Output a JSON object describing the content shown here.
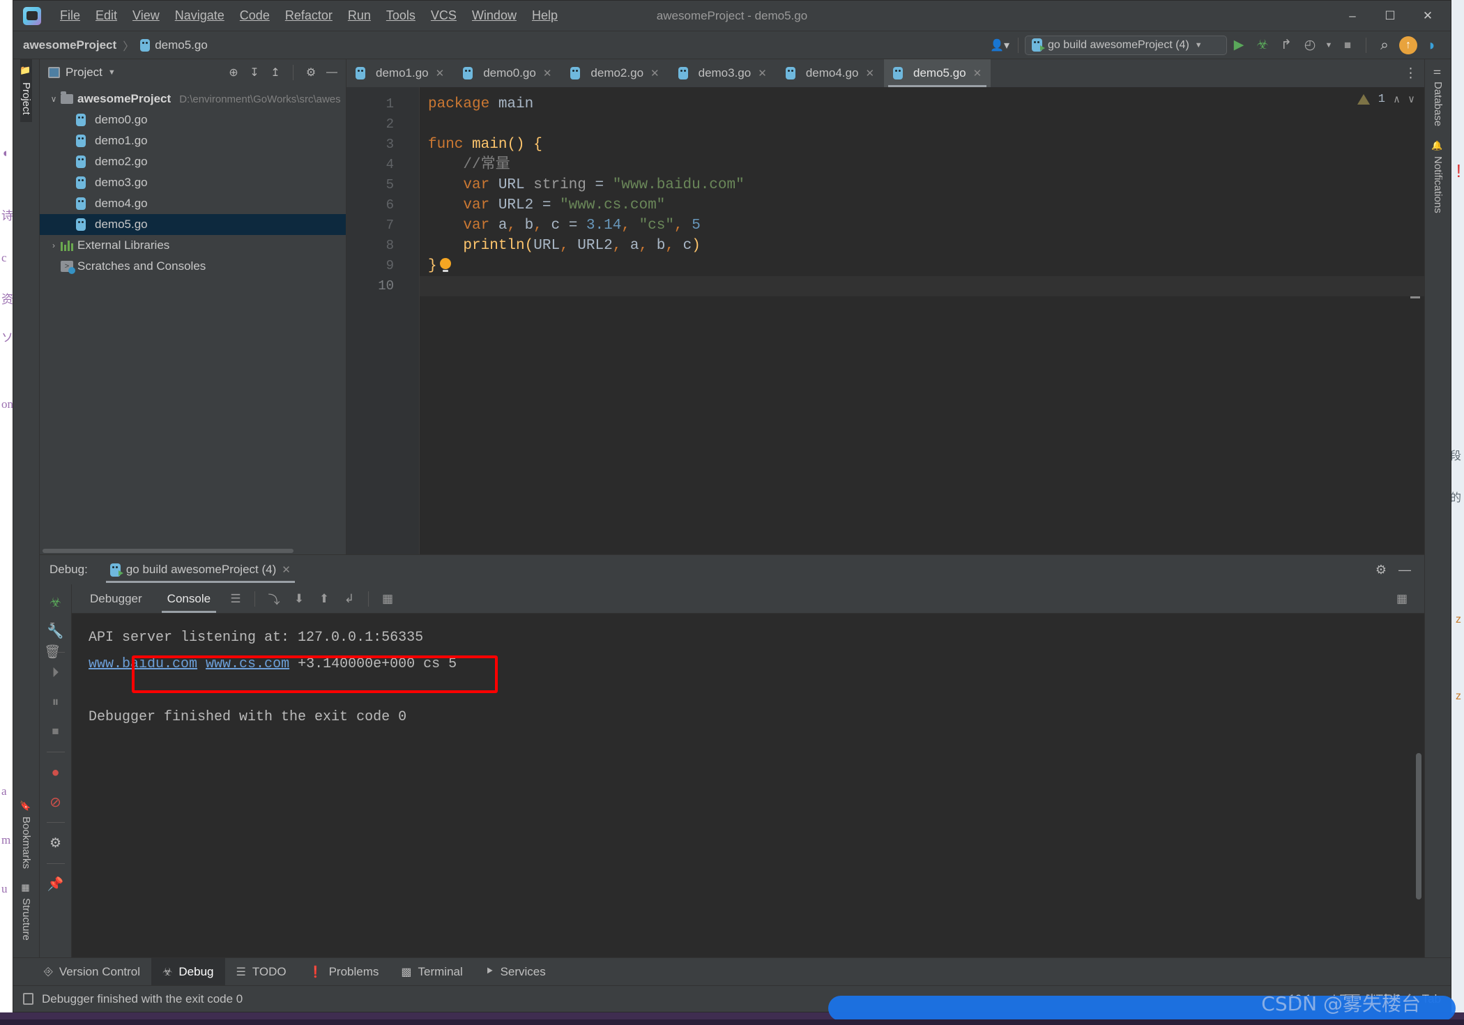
{
  "window": {
    "title": "awesomeProject - demo5.go",
    "app_icon": "go-logo-icon",
    "minimize": "–",
    "maximize": "☐",
    "close": "✕"
  },
  "menubar": {
    "items": [
      {
        "label": "File"
      },
      {
        "label": "Edit"
      },
      {
        "label": "View"
      },
      {
        "label": "Navigate"
      },
      {
        "label": "Code"
      },
      {
        "label": "Refactor"
      },
      {
        "label": "Run"
      },
      {
        "label": "Tools"
      },
      {
        "label": "VCS"
      },
      {
        "label": "Window"
      },
      {
        "label": "Help"
      }
    ]
  },
  "navbar": {
    "breadcrumb": [
      {
        "label": "awesomeProject",
        "bold": true
      },
      {
        "label": "demo5.go",
        "bold": false,
        "icon": "go-file-icon"
      }
    ],
    "separator": "〉",
    "user_icon": "user-avatar-icon",
    "run_config": {
      "icon": "go-run-config-icon",
      "label": "go build awesomeProject (4)",
      "caret": "▼"
    },
    "buttons": [
      {
        "name": "run-button",
        "glyph": "▶",
        "color": "#5aa85a"
      },
      {
        "name": "debug-button",
        "glyph": "☣",
        "color": "#5aa85a"
      },
      {
        "name": "run-with-coverage-button",
        "glyph": "↱",
        "color": "#b0b0b0"
      },
      {
        "name": "profiler-button",
        "glyph": "◴",
        "color": "#b0b0b0"
      },
      {
        "name": "profiler-dropdown",
        "glyph": "▼",
        "color": "#b0b0b0"
      },
      {
        "name": "stop-button",
        "glyph": "■",
        "color": "#9a9a9a"
      },
      {
        "name": "search-everywhere-button",
        "glyph": "⌕",
        "color": "#c8c8c8"
      },
      {
        "name": "update-button",
        "glyph": "↑",
        "color": "#e8a33d"
      },
      {
        "name": "ide-feature-button",
        "glyph": "◗",
        "color": "#3aa0d8"
      }
    ]
  },
  "left_strip": {
    "top_tabs": [
      {
        "label": "Project",
        "icon": "folder-icon",
        "active": true
      }
    ],
    "bottom_tabs": [
      {
        "label": "Bookmarks",
        "icon": "bookmark-icon",
        "active": false
      },
      {
        "label": "Structure",
        "icon": "structure-icon",
        "active": false
      }
    ]
  },
  "right_strip": {
    "tabs": [
      {
        "label": "Database",
        "icon": "database-icon"
      },
      {
        "label": "Notifications",
        "icon": "bell-icon"
      }
    ]
  },
  "project_panel": {
    "title": "Project",
    "title_caret": "▼",
    "tools": [
      {
        "name": "select-opened-file-button",
        "glyph": "⊕"
      },
      {
        "name": "expand-all-button",
        "glyph": "↧"
      },
      {
        "name": "collapse-all-button",
        "glyph": "↥"
      },
      {
        "name": "settings-button",
        "glyph": "⚙"
      },
      {
        "name": "hide-button",
        "glyph": "—"
      }
    ],
    "tree": [
      {
        "name": "awesomeProject",
        "path": "D:\\environment\\GoWorks\\src\\awes",
        "arrow": "∨",
        "icon": "folder-icon",
        "depth": 0,
        "bold": true,
        "selected": false
      },
      {
        "name": "demo0.go",
        "path": "",
        "arrow": "",
        "icon": "go-file-icon",
        "depth": 1,
        "bold": false,
        "selected": false
      },
      {
        "name": "demo1.go",
        "path": "",
        "arrow": "",
        "icon": "go-file-icon",
        "depth": 1,
        "bold": false,
        "selected": false
      },
      {
        "name": "demo2.go",
        "path": "",
        "arrow": "",
        "icon": "go-file-icon",
        "depth": 1,
        "bold": false,
        "selected": false
      },
      {
        "name": "demo3.go",
        "path": "",
        "arrow": "",
        "icon": "go-file-icon",
        "depth": 1,
        "bold": false,
        "selected": false
      },
      {
        "name": "demo4.go",
        "path": "",
        "arrow": "",
        "icon": "go-file-icon",
        "depth": 1,
        "bold": false,
        "selected": false
      },
      {
        "name": "demo5.go",
        "path": "",
        "arrow": "",
        "icon": "go-file-icon",
        "depth": 1,
        "bold": false,
        "selected": true
      },
      {
        "name": "External Libraries",
        "path": "",
        "arrow": "›",
        "icon": "libraries-icon",
        "depth": 0,
        "bold": false,
        "selected": false
      },
      {
        "name": "Scratches and Consoles",
        "path": "",
        "arrow": "",
        "icon": "scratches-icon",
        "depth": 0,
        "bold": false,
        "selected": false
      }
    ]
  },
  "editor": {
    "tabs": [
      {
        "label": "demo1.go",
        "active": false,
        "close": "✕"
      },
      {
        "label": "demo0.go",
        "active": false,
        "close": "✕"
      },
      {
        "label": "demo2.go",
        "active": false,
        "close": "✕"
      },
      {
        "label": "demo3.go",
        "active": false,
        "close": "✕"
      },
      {
        "label": "demo4.go",
        "active": false,
        "close": "✕"
      },
      {
        "label": "demo5.go",
        "active": true,
        "close": "✕"
      }
    ],
    "tabs_overflow": "⋮",
    "inspection": {
      "count": "1",
      "warn_icon": "warning-triangle-icon",
      "prev": "∧",
      "next": "∨"
    },
    "line_numbers": [
      "1",
      "2",
      "3",
      "4",
      "5",
      "6",
      "7",
      "8",
      "9",
      "10"
    ],
    "code_lines": [
      {
        "n": 1,
        "tokens": [
          {
            "t": "package",
            "c": "k-keyword"
          },
          {
            "t": " main",
            "c": "k-ident"
          }
        ]
      },
      {
        "n": 2,
        "tokens": []
      },
      {
        "n": 3,
        "tokens": [
          {
            "t": "func ",
            "c": "k-keyword"
          },
          {
            "t": "main",
            "c": "k-fn"
          },
          {
            "t": "() {",
            "c": "k-brace1"
          }
        ],
        "run_marker": true,
        "fold": "−"
      },
      {
        "n": 4,
        "tokens": [
          {
            "t": "    //常量",
            "c": "k-com"
          }
        ]
      },
      {
        "n": 5,
        "tokens": [
          {
            "t": "    var ",
            "c": "k-keyword"
          },
          {
            "t": "URL ",
            "c": "k-ident"
          },
          {
            "t": "string ",
            "c": "k-type"
          },
          {
            "t": "= ",
            "c": "k-punc"
          },
          {
            "t": "\"www.baidu.com\"",
            "c": "k-str"
          }
        ]
      },
      {
        "n": 6,
        "tokens": [
          {
            "t": "    var ",
            "c": "k-keyword"
          },
          {
            "t": "URL2 ",
            "c": "k-ident"
          },
          {
            "t": "= ",
            "c": "k-punc"
          },
          {
            "t": "\"www.cs.com\"",
            "c": "k-str"
          }
        ]
      },
      {
        "n": 7,
        "tokens": [
          {
            "t": "    var ",
            "c": "k-keyword"
          },
          {
            "t": "a",
            "c": "k-ident"
          },
          {
            "t": ", ",
            "c": "k-keyword"
          },
          {
            "t": "b",
            "c": "k-ident"
          },
          {
            "t": ", ",
            "c": "k-keyword"
          },
          {
            "t": "c ",
            "c": "k-ident"
          },
          {
            "t": "= ",
            "c": "k-punc"
          },
          {
            "t": "3.14",
            "c": "k-num"
          },
          {
            "t": ", ",
            "c": "k-keyword"
          },
          {
            "t": "\"cs\"",
            "c": "k-str"
          },
          {
            "t": ", ",
            "c": "k-keyword"
          },
          {
            "t": "5",
            "c": "k-num"
          }
        ]
      },
      {
        "n": 8,
        "tokens": [
          {
            "t": "    ",
            "c": "k-ident"
          },
          {
            "t": "println",
            "c": "k-fn"
          },
          {
            "t": "(",
            "c": "k-brace1"
          },
          {
            "t": "URL",
            "c": "k-ident"
          },
          {
            "t": ", ",
            "c": "k-keyword"
          },
          {
            "t": "URL2",
            "c": "k-ident"
          },
          {
            "t": ", ",
            "c": "k-keyword"
          },
          {
            "t": "a",
            "c": "k-ident"
          },
          {
            "t": ", ",
            "c": "k-keyword"
          },
          {
            "t": "b",
            "c": "k-ident"
          },
          {
            "t": ", ",
            "c": "k-keyword"
          },
          {
            "t": "c",
            "c": "k-ident"
          },
          {
            "t": ")",
            "c": "k-brace1"
          }
        ]
      },
      {
        "n": 9,
        "tokens": [
          {
            "t": "}",
            "c": "k-brace1"
          }
        ],
        "fold": "−",
        "bulb": true
      },
      {
        "n": 10,
        "tokens": []
      }
    ]
  },
  "debug_panel": {
    "label": "Debug:",
    "session": {
      "label": "go build awesomeProject (4)",
      "icon": "go-run-config-icon",
      "close": "✕"
    },
    "header_tools": [
      {
        "name": "debug-settings-button",
        "glyph": "⚙"
      },
      {
        "name": "hide-debug-button",
        "glyph": "—"
      }
    ],
    "side_buttons": [
      {
        "name": "debugger-icon",
        "glyph": "☣",
        "color": "#5aa85a"
      },
      {
        "name": "settings-wrench-icon",
        "glyph": "ὒ7",
        "color": "#b4b4b4"
      },
      {
        "name": "resume-program-button",
        "glyph": "⏵",
        "color": "#7a7a7a"
      },
      {
        "name": "pause-program-button",
        "glyph": "⏸",
        "color": "#7a7a7a"
      },
      {
        "name": "stop-program-button",
        "glyph": "⏹",
        "color": "#7a7a7a"
      },
      {
        "name": "view-breakpoints-button",
        "glyph": "●",
        "color": "#d0504a"
      },
      {
        "name": "mute-breakpoints-button",
        "glyph": "⊘",
        "color": "#d0504a"
      },
      {
        "name": "debug-settings-gear-button",
        "glyph": "⚙",
        "color": "#b4b4b4"
      },
      {
        "name": "pin-tab-button",
        "glyph": "✔",
        "color": "#b4b4b4"
      }
    ],
    "sub_tabs": [
      {
        "label": "Debugger",
        "active": false
      },
      {
        "label": "Console",
        "active": true
      }
    ],
    "toolbar_buttons": [
      {
        "name": "show-console-button",
        "glyph": "☰"
      },
      {
        "name": "step-over-button",
        "glyph": "⤵"
      },
      {
        "name": "step-into-button",
        "glyph": "⬇"
      },
      {
        "name": "step-out-button",
        "glyph": "⬆"
      },
      {
        "name": "run-to-cursor-button",
        "glyph": "↲"
      },
      {
        "name": "evaluate-expression-button",
        "glyph": "▦"
      }
    ],
    "toolbar_right": [
      {
        "name": "layout-settings-button",
        "glyph": "▦"
      }
    ],
    "console_side_buttons": [
      {
        "name": "scroll-to-end-button",
        "glyph": "↧"
      },
      {
        "name": "clear-all-button",
        "glyph": "Ὕ1"
      }
    ],
    "console_lines": [
      {
        "text": "API server listening at: 127.0.0.1:56335",
        "type": "plain"
      },
      {
        "type": "mixed",
        "parts": [
          {
            "t": "www.baidu.com",
            "link": true
          },
          {
            "t": " ",
            "link": false
          },
          {
            "t": "www.cs.com",
            "link": true
          },
          {
            "t": " +3.140000e+000 cs 5",
            "link": false
          }
        ]
      },
      {
        "text": "",
        "type": "plain"
      },
      {
        "text": "Debugger finished with the exit code 0",
        "type": "plain"
      }
    ],
    "highlight_box_color": "#ff0000"
  },
  "tool_tabs": [
    {
      "label": "Version Control",
      "icon": "branch-icon",
      "active": false
    },
    {
      "label": "Debug",
      "icon": "bug-icon",
      "active": true
    },
    {
      "label": "TODO",
      "icon": "list-icon",
      "active": false
    },
    {
      "label": "Problems",
      "icon": "exclamation-icon",
      "active": false
    },
    {
      "label": "Terminal",
      "icon": "terminal-icon",
      "active": false
    },
    {
      "label": "Services",
      "icon": "services-icon",
      "active": false
    }
  ],
  "statusbar": {
    "message": "Debugger finished with the exit code 0",
    "message_icon": "document-icon",
    "caret_position": "10:1",
    "line_separator": "LF",
    "encoding": "UTF-8",
    "indent": "Tab",
    "indent_caret": "▾"
  },
  "watermark": {
    "text": "CSDN @雾失楼台"
  },
  "background_fragments": {
    "left": [
      "◖",
      "诗",
      "c",
      "资",
      "ソ",
      "on",
      "a",
      "m",
      "u"
    ],
    "right": [
      "!",
      "段",
      "的",
      "z",
      "z"
    ]
  }
}
